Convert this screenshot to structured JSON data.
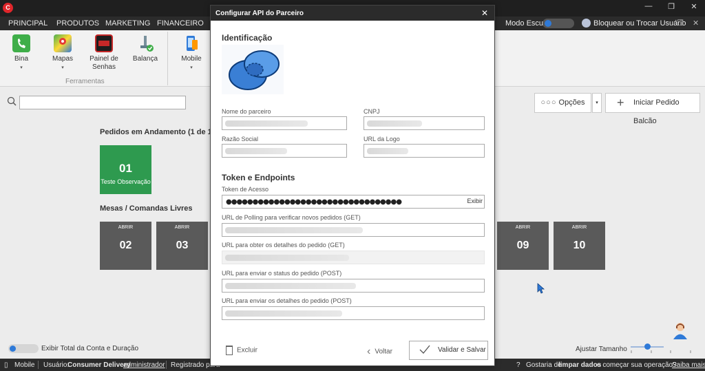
{
  "window": {
    "logo_letter": "C",
    "min": "—",
    "max": "❐",
    "close": "✕"
  },
  "menu": {
    "items": [
      "PRINCIPAL",
      "PRODUTOS",
      "MARKETING",
      "FINANCEIRO"
    ],
    "dark_mode_label": "Modo Escuro",
    "lock_label": "Bloquear ou Trocar Usuário",
    "restore": "❐",
    "close": "✕"
  },
  "ribbon": {
    "buttons": [
      {
        "label": "Bina",
        "icon": "phone-icon",
        "color": "#3fae49",
        "caret": "▾"
      },
      {
        "label": "Mapas",
        "icon": "map-icon",
        "color": "#4caf50",
        "caret": "▾"
      },
      {
        "label": "Painel de Senhas",
        "icon": "ticket-display-icon",
        "color": "#c62828",
        "caret": ""
      },
      {
        "label": "Balança",
        "icon": "scale-icon",
        "color": "#607d8b",
        "caret": ""
      },
      {
        "label": "Mobile",
        "icon": "mobile-icon",
        "color": "#2f7ad8",
        "caret": "▾"
      }
    ],
    "group_label": "Ferramentas"
  },
  "main": {
    "options_label": "Opções",
    "options_caret": "▾",
    "balcao_label": "Iniciar Pedido Balcão",
    "orders_title": "Pedidos em Andamento (1 de 1)",
    "order": {
      "number": "01",
      "note": "Teste Observação",
      "color": "#2e9a4f"
    },
    "tables_title": "Mesas / Comandas Livres",
    "tables": [
      {
        "abrir": "ABRIR",
        "num": "02"
      },
      {
        "abrir": "ABRIR",
        "num": "03"
      },
      {
        "abrir": "ABRIR",
        "num": "09"
      },
      {
        "abrir": "ABRIR",
        "num": "10"
      }
    ],
    "exibir_label": "Exibir Total da Conta e Duração",
    "ajustar_label": "Ajustar Tamanho",
    "zoom_level": 0.45
  },
  "status": {
    "mobile": "Mobile",
    "user_prefix": "Usuário:",
    "user_company": "Consumer Delivery",
    "user_name": "administrador",
    "registered": "Registrado para",
    "question_pre": "Gostaria de",
    "question_bold": "limpar dados",
    "question_post": "e começar sua operação?",
    "saiba": "Saiba mais"
  },
  "modal": {
    "title": "Configurar API do Parceiro",
    "close": "✕",
    "section_id": "Identificação",
    "labels": {
      "nome": "Nome do parceiro",
      "cnpj": "CNPJ",
      "razao": "Razão Social",
      "url_logo": "URL da Logo"
    },
    "section_token": "Token e Endpoints",
    "token_label": "Token de Acesso",
    "token_value": "●●●●●●●●●●●●●●●●●●●●●●●●●●●●●●●●●",
    "exibir": "Exibir",
    "endpoints": [
      "URL de Polling para verificar novos pedidos (GET)",
      "URL para obter os detalhes do pedido (GET)",
      "URL para enviar o status do pedido (POST)",
      "URL para enviar os detalhes do pedido (POST)"
    ],
    "excluir": "Excluir",
    "voltar": "Voltar",
    "validar": "Validar e Salvar"
  }
}
